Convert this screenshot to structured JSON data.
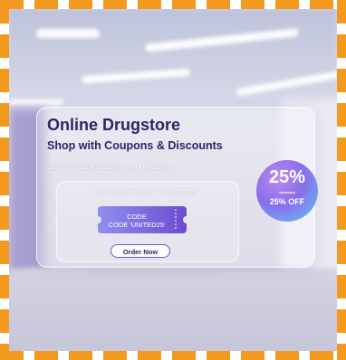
{
  "promo": {
    "title": "Online Drugstore",
    "subtitle": "Shop with Coupons & Discounts",
    "description": "Get UPTO 25% Discount on All Medicines",
    "coupon_instruction": "Use Coupon Code - UNITED25",
    "ticket_line1": "CODE",
    "ticket_line2": "CODE 'UNITED25'",
    "order_button": "Order Now",
    "badge_percent": "25%",
    "badge_off": "25% OFF"
  },
  "colors": {
    "border_dash": "#f39a1e",
    "title_text": "#2e2467",
    "accent_purple": "#6f5ac4",
    "ticket_start": "#8f8ff0",
    "ticket_end": "#6d4bd0"
  }
}
